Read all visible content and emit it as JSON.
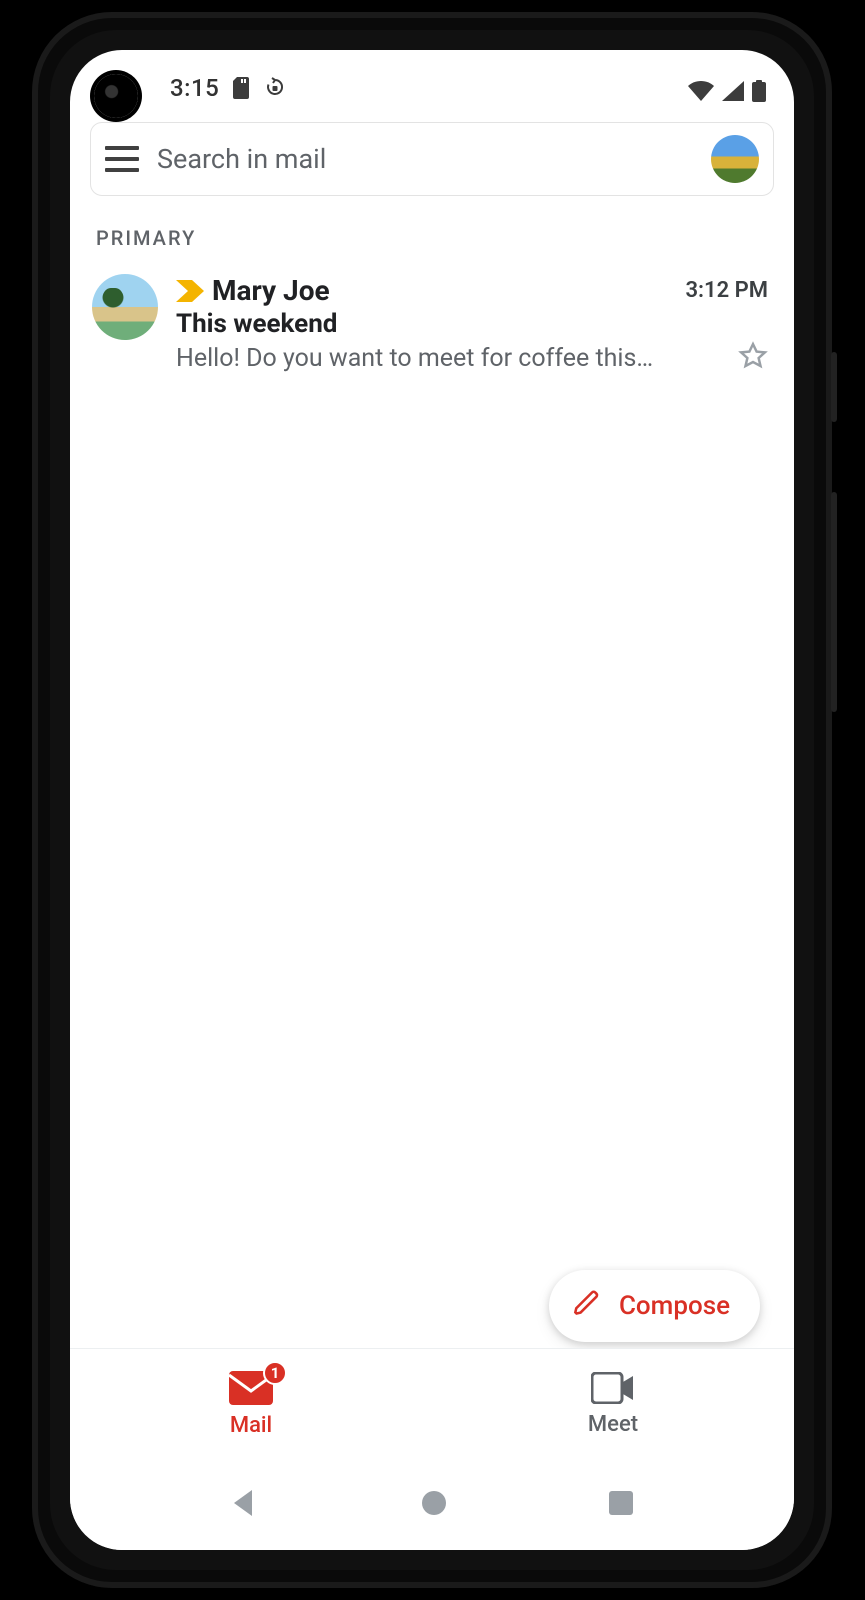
{
  "statusbar": {
    "time": "3:15"
  },
  "search": {
    "placeholder": "Search in mail"
  },
  "section": {
    "label": "PRIMARY"
  },
  "emails": [
    {
      "sender": "Mary Joe",
      "time": "3:12 PM",
      "subject": "This weekend",
      "snippet": "Hello! Do you want to meet for coffee this…"
    }
  ],
  "compose": {
    "label": "Compose"
  },
  "tabs": {
    "mail": {
      "label": "Mail",
      "badge": "1"
    },
    "meet": {
      "label": "Meet"
    }
  },
  "colors": {
    "accent": "#d93025",
    "chevron": "#f4b400"
  }
}
